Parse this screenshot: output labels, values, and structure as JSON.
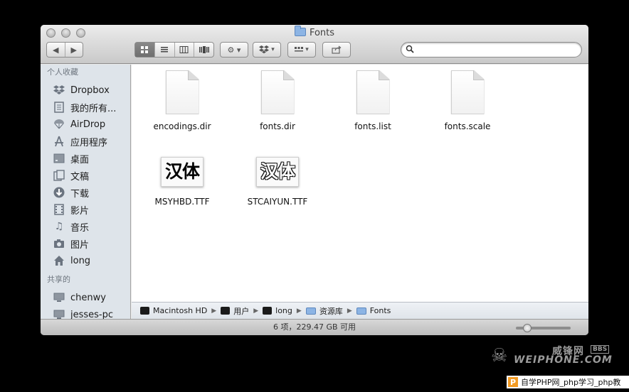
{
  "window": {
    "title": "Fonts"
  },
  "toolbar": {
    "back": "◀",
    "forward": "▶",
    "views": [
      "icon-view",
      "list-view",
      "column-view",
      "coverflow-view"
    ],
    "action": "⚙ ▾",
    "dropbox": "▾",
    "arrange": "▾",
    "share": "share-icon",
    "search_value": ""
  },
  "sidebar": {
    "favorites_header": "个人收藏",
    "favorites": [
      {
        "label": "Dropbox",
        "icon": "dropbox-icon"
      },
      {
        "label": "我的所有...",
        "icon": "all-files-icon"
      },
      {
        "label": "AirDrop",
        "icon": "airdrop-icon"
      },
      {
        "label": "应用程序",
        "icon": "applications-icon"
      },
      {
        "label": "桌面",
        "icon": "desktop-icon"
      },
      {
        "label": "文稿",
        "icon": "documents-icon"
      },
      {
        "label": "下载",
        "icon": "downloads-icon"
      },
      {
        "label": "影片",
        "icon": "movies-icon"
      },
      {
        "label": "音乐",
        "icon": "music-icon"
      },
      {
        "label": "图片",
        "icon": "pictures-icon"
      },
      {
        "label": "long",
        "icon": "home-icon"
      }
    ],
    "shared_header": "共享的",
    "shared": [
      {
        "label": "chenwy",
        "icon": "computer-icon"
      },
      {
        "label": "jesses-pc",
        "icon": "computer-icon"
      }
    ]
  },
  "files": [
    {
      "name": "encodings.dir",
      "kind": "document"
    },
    {
      "name": "fonts.dir",
      "kind": "document"
    },
    {
      "name": "fonts.list",
      "kind": "document"
    },
    {
      "name": "fonts.scale",
      "kind": "document"
    },
    {
      "name": "MSYHBD.TTF",
      "kind": "font",
      "preview": "汉体"
    },
    {
      "name": "STCAIYUN.TTF",
      "kind": "font",
      "preview": "汉体"
    }
  ],
  "path": [
    "Macintosh HD",
    "用户",
    "long",
    "资源库",
    "Fonts"
  ],
  "status": "6 项，229.47 GB 可用",
  "watermarks": {
    "site_cn": "威锋网",
    "site_bbs": "BBS",
    "site_en": "WEIPHONE.COM",
    "php_logo": "P",
    "php_text": "自学PHP网_php学习_php教"
  }
}
